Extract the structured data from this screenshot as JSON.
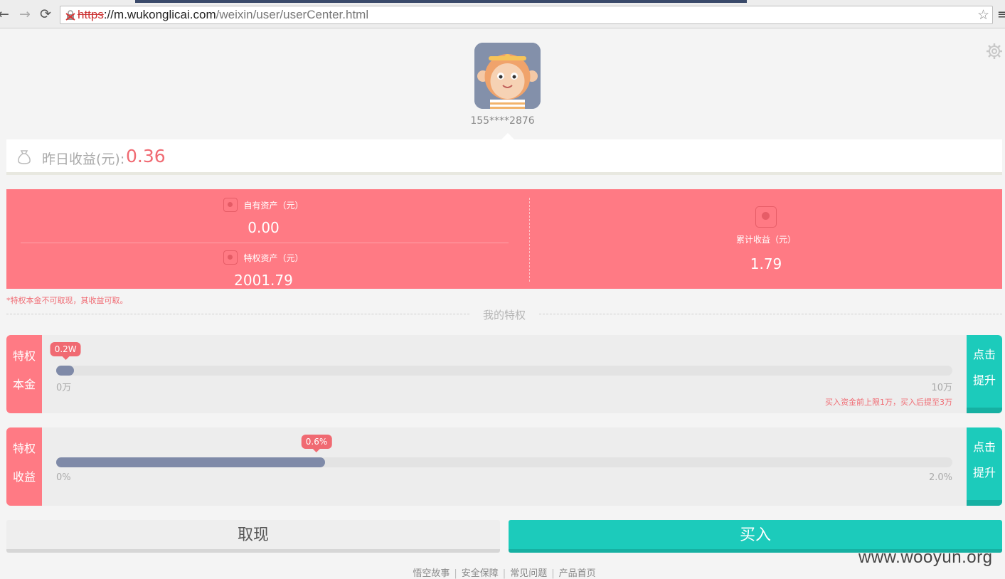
{
  "browser": {
    "url_scheme": "https",
    "url_host": "://m.wukonglicai.com",
    "url_path": "/weixin/user/userCenter.html"
  },
  "profile": {
    "phone": "155****2876"
  },
  "yesterday": {
    "label": "昨日收益(元):",
    "value": "0.36"
  },
  "assets": {
    "own_label": "自有资产（元）",
    "own_value": "0.00",
    "privilege_label": "特权资产（元）",
    "privilege_value": "2001.79",
    "total_label": "累计收益（元）",
    "total_value": "1.79"
  },
  "note": "*特权本金不可取现，其收益可取。",
  "section_title": "我的特权",
  "principal": {
    "tag_line1": "特权",
    "tag_line2": "本金",
    "bubble": "0.2W",
    "progress_fraction": 0.02,
    "min_label": "0万",
    "max_label": "10万",
    "limit_note": "买入资金前上限1万，买入后提至3万",
    "btn_line1": "点击",
    "btn_line2": "提升"
  },
  "yield": {
    "tag_line1": "特权",
    "tag_line2": "收益",
    "bubble": "0.6%",
    "progress_fraction": 0.3,
    "min_label": "0%",
    "max_label": "2.0%",
    "btn_line1": "点击",
    "btn_line2": "提升"
  },
  "actions": {
    "withdraw": "取现",
    "buy": "买入"
  },
  "footer": {
    "links": [
      "悟空故事",
      "安全保障",
      "常见问题",
      "产品首页"
    ],
    "separator": "|"
  },
  "watermark": "www.wooyun.org",
  "colors": {
    "accent_red": "#ff7a84",
    "accent_teal": "#1ccbbb",
    "progress": "#7f8aa8"
  }
}
